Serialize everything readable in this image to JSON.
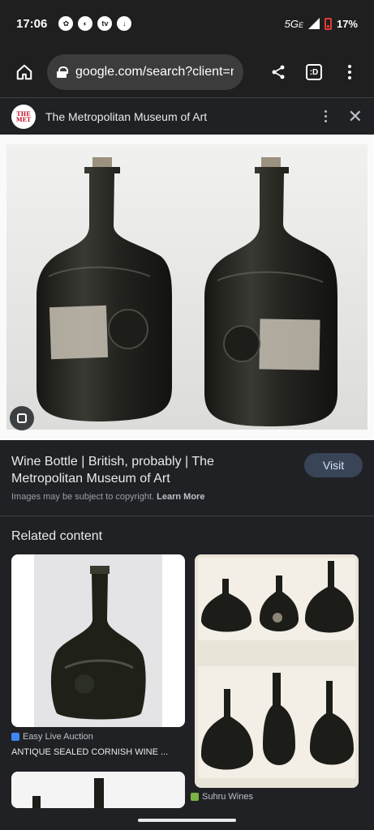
{
  "status_bar": {
    "time": "17:06",
    "network": "5G",
    "network_suffix": "E",
    "battery": "17%",
    "battery_color": "#e53935"
  },
  "browser": {
    "url": "google.com/search?client=ms",
    "tab_count": ":D"
  },
  "source": {
    "logo_line1": "THE",
    "logo_line2": "MET",
    "title": "The Metropolitan Museum of Art"
  },
  "result": {
    "title": "Wine Bottle | British, probably | The Metropolitan Museum of Art",
    "visit_label": "Visit",
    "copyright_text": "Images may be subject to copyright.",
    "learn_more": "Learn More"
  },
  "related": {
    "heading": "Related content",
    "items": [
      {
        "source": "Easy Live Auction",
        "caption": "ANTIQUE SEALED CORNISH WINE ...",
        "favicon_color": "#4285f4"
      },
      {
        "source": "Suhru Wines",
        "caption": "",
        "favicon_color": "#7cb342"
      }
    ]
  },
  "colors": {
    "background": "#202124",
    "visit_button": "#394457",
    "bottle_glass": "#2b2b26"
  }
}
